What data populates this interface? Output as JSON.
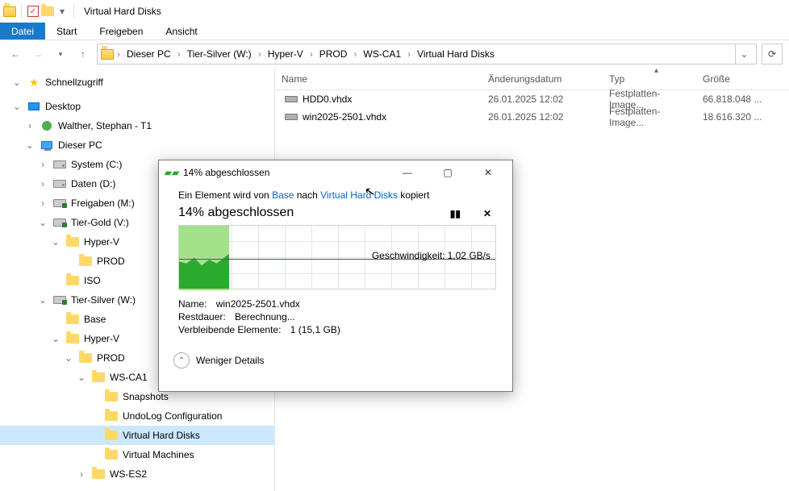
{
  "titlebar": {
    "title": "Virtual Hard Disks"
  },
  "ribbon": {
    "datei": "Datei",
    "start": "Start",
    "freigeben": "Freigeben",
    "ansicht": "Ansicht"
  },
  "breadcrumbs": [
    "Dieser PC",
    "Tier-Silver (W:)",
    "Hyper-V",
    "PROD",
    "WS-CA1",
    "Virtual Hard Disks"
  ],
  "columns": {
    "name": "Name",
    "date": "Änderungsdatum",
    "type": "Typ",
    "size": "Größe"
  },
  "files": [
    {
      "name": "HDD0.vhdx",
      "date": "26.01.2025 12:02",
      "type": "Festplatten-Image...",
      "size": "66.818.048 ..."
    },
    {
      "name": "win2025-2501.vhdx",
      "date": "26.01.2025 12:02",
      "type": "Festplatten-Image...",
      "size": "18.616.320 ..."
    }
  ],
  "tree": {
    "quickaccess": "Schnellzugriff",
    "desktop": "Desktop",
    "user": "Walther, Stephan - T1",
    "thispc": "Dieser PC",
    "systemc": "System (C:)",
    "datend": "Daten (D:)",
    "freigm": "Freigaben (M:)",
    "tiergold": "Tier-Gold (V:)",
    "hyperv1": "Hyper-V",
    "prod1": "PROD",
    "iso": "ISO",
    "tiersilver": "Tier-Silver (W:)",
    "base": "Base",
    "hyperv2": "Hyper-V",
    "prod2": "PROD",
    "wsca1": "WS-CA1",
    "snapshots": "Snapshots",
    "undolog": "UndoLog Configuration",
    "vhd": "Virtual Hard Disks",
    "vm": "Virtual Machines",
    "wses2": "WS-ES2"
  },
  "dialog": {
    "title": "14% abgeschlossen",
    "line_pre": "Ein Element wird von ",
    "src": "Base",
    "line_mid": " nach ",
    "dst": "Virtual Hard Disks",
    "line_post": " kopiert",
    "percent": "14% abgeschlossen",
    "speed_label": "Geschwindigkeit:",
    "speed_value": "1,02 GB/s",
    "name_label": "Name:",
    "name_value": "win2025-2501.vhdx",
    "rest_label": "Restdauer:",
    "rest_value": "Berechnung...",
    "remain_label": "Verbleibende Elemente:",
    "remain_value": "1 (15,1 GB)",
    "details": "Weniger Details"
  }
}
